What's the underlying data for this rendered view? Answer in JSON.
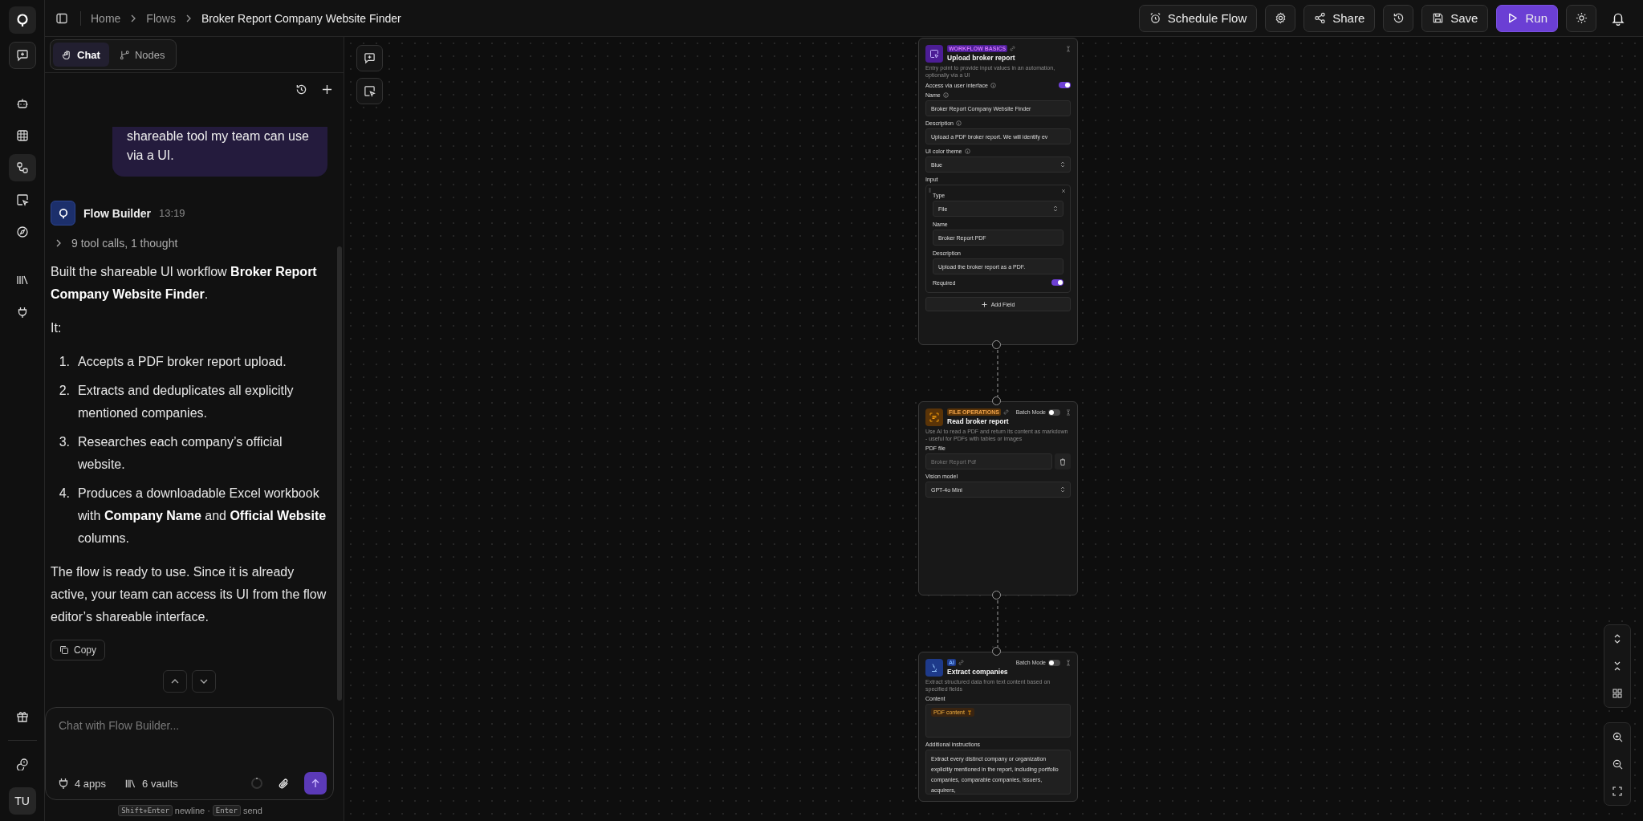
{
  "rail": {
    "avatar": "TU"
  },
  "breadcrumb": [
    {
      "label": "Home"
    },
    {
      "label": "Flows"
    },
    {
      "label": "Broker Report Company Website Finder"
    }
  ],
  "toolbar": [
    {
      "kind": "schedule",
      "label": "Schedule Flow"
    },
    {
      "kind": "settings"
    },
    {
      "kind": "share",
      "label": "Share"
    },
    {
      "kind": "history"
    },
    {
      "kind": "save",
      "label": "Save"
    },
    {
      "kind": "run",
      "label": "Run"
    },
    {
      "kind": "theme"
    },
    {
      "kind": "bell"
    }
  ],
  "chat": {
    "tabs": [
      {
        "label": "Chat",
        "selected": true
      },
      {
        "label": "Nodes",
        "selected": false
      }
    ],
    "user_message": "shareable tool my team can use via a UI.",
    "assistant": {
      "name": "Flow Builder",
      "time": "13:19",
      "tool_summary": "9 tool calls, 1 thought",
      "intro": "Built the shareable UI workflow **Broker Report Company Website Finder**.",
      "lead": "It:",
      "steps": [
        {
          "number": "1.",
          "text": "Accepts a PDF broker report upload."
        },
        {
          "number": "2.",
          "text": "Extracts and deduplicates all explicitly mentioned companies."
        },
        {
          "number": "3.",
          "text": "Researches each company’s official website."
        },
        {
          "number": "4.",
          "text": "Produces a downloadable Excel workbook with **Company Name** and **Official Website** columns."
        }
      ],
      "closing": "The flow is ready to use. Since it is already active, your team can access its UI from the flow editor’s shareable interface.",
      "copy_label": "Copy"
    },
    "input": {
      "placeholder": "Chat with Flow Builder...",
      "apps": "4 apps",
      "vaults": "6 vaults"
    },
    "hint": [
      {
        "kind": "key",
        "text": "Shift+Enter"
      },
      {
        "kind": "word",
        "text": "newline ·"
      },
      {
        "kind": "key",
        "text": "Enter"
      },
      {
        "kind": "word",
        "text": "send"
      }
    ]
  },
  "nodes": [
    {
      "category": "WORKFLOW BASICS",
      "color": "#4c1d95",
      "title": "Upload broker report",
      "description": "Entry point to provide input values in an automation, optionally via a UI",
      "fields": [
        {
          "kind": "toggle",
          "label": "Access via user interface",
          "help": true,
          "on": true
        },
        {
          "kind": "text",
          "label": "Name",
          "help": true,
          "value": "Broker Report Company Website Finder"
        },
        {
          "kind": "text",
          "label": "Description",
          "help": true,
          "value": "Upload a PDF broker report. We will identify ev"
        },
        {
          "kind": "select",
          "label": "UI color theme",
          "help": true,
          "value": "Blue"
        },
        {
          "kind": "group",
          "label": "Input",
          "children": [
            {
              "kind": "select",
              "label": "Type",
              "value": "File"
            },
            {
              "kind": "text",
              "label": "Name",
              "value": "Broker Report PDF"
            },
            {
              "kind": "text",
              "label": "Description",
              "value": "Upload the broker report as a PDF."
            },
            {
              "kind": "toggle",
              "label": "Required",
              "on": true
            }
          ]
        },
        {
          "kind": "button",
          "label": "Add Field"
        }
      ]
    },
    {
      "category": "FILE OPERATIONS",
      "color": "#5a3408",
      "title": "Read broker report",
      "description": "Use AI to read a PDF and return its content as markdown - useful for PDFs with tables or images",
      "batch_mode": {
        "label": "Batch Mode",
        "on": false
      },
      "fields": [
        {
          "kind": "file",
          "label": "PDF file",
          "placeholder": "Broker Report Pdf"
        },
        {
          "kind": "select",
          "label": "Vision model",
          "value": "GPT-4o Mini"
        }
      ]
    },
    {
      "category": "AI",
      "color": "#1e3a8a",
      "title": "Extract companies",
      "description": "Extract structured data from text content based on specified fields",
      "batch_mode": {
        "label": "Batch Mode",
        "on": false
      },
      "fields": [
        {
          "kind": "tags",
          "label": "Content",
          "tags": [
            "PDF content"
          ]
        },
        {
          "kind": "textarea",
          "label": "Additional instructions",
          "value": "Extract every distinct company or organization explicitly mentioned in the report, including portfolio companies, comparable companies, issuers, acquirers,"
        }
      ]
    }
  ]
}
